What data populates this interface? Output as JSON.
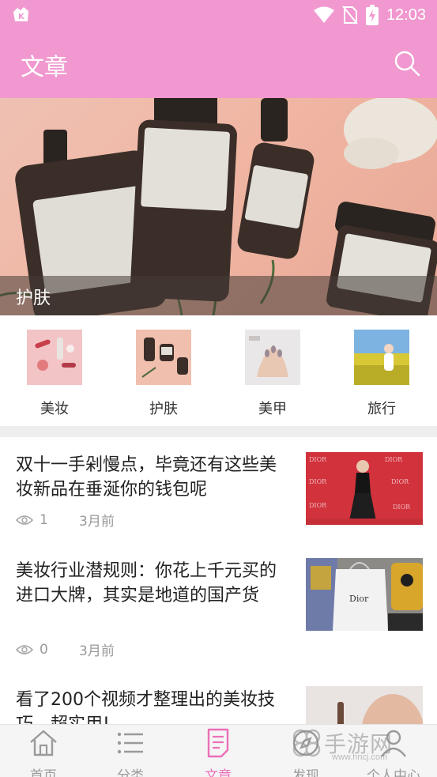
{
  "status": {
    "time": "12:03"
  },
  "header": {
    "title": "文章"
  },
  "banner": {
    "caption": "护肤"
  },
  "categories": [
    {
      "label": "美妆"
    },
    {
      "label": "护肤"
    },
    {
      "label": "美甲"
    },
    {
      "label": "旅行"
    }
  ],
  "articles": [
    {
      "title": "双十一手剁慢点，毕竟还有这些美妆新品在垂涎你的钱包呢",
      "views": "1",
      "time": "3月前"
    },
    {
      "title": "美妆行业潜规则：你花上千元买的进口大牌，其实是地道的国产货",
      "views": "0",
      "time": "3月前"
    },
    {
      "title": "看了200个视频才整理出的美妆技巧，超实用!",
      "views": "",
      "time": ""
    }
  ],
  "nav": [
    {
      "label": "首页"
    },
    {
      "label": "分类"
    },
    {
      "label": "文章"
    },
    {
      "label": "发现"
    },
    {
      "label": "个人中心"
    }
  ],
  "watermark": {
    "text": "手游网",
    "url": "www.hncj.com"
  },
  "colors": {
    "accent": "#f098cf",
    "active_nav": "#ec6fb8"
  }
}
